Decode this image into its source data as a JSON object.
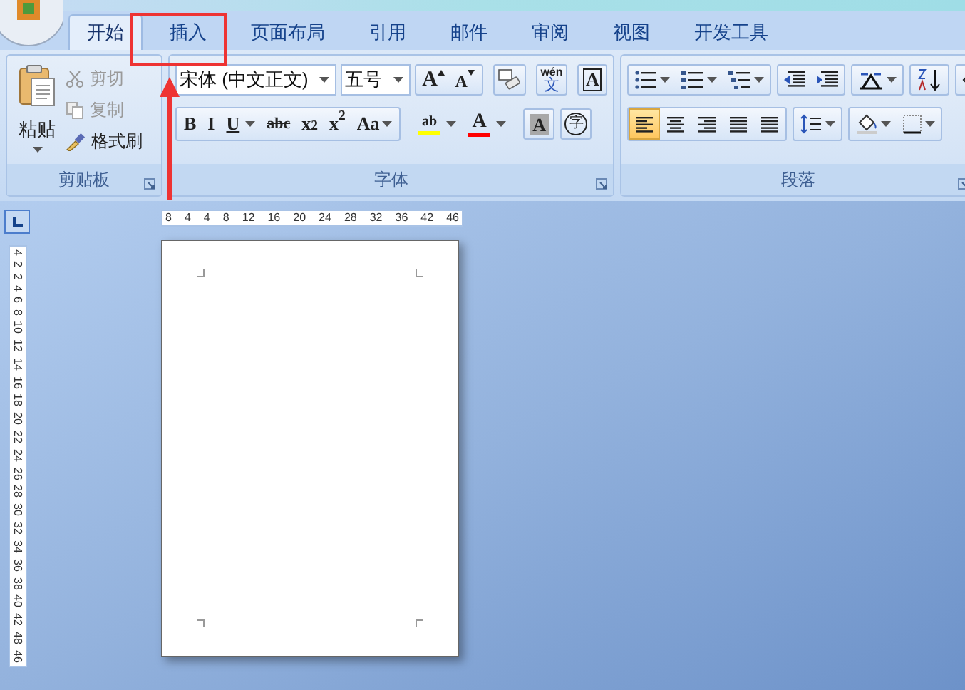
{
  "tabs": [
    {
      "label": "开始",
      "selected": true
    },
    {
      "label": "插入",
      "selected": false
    },
    {
      "label": "页面布局",
      "selected": false
    },
    {
      "label": "引用",
      "selected": false
    },
    {
      "label": "邮件",
      "selected": false
    },
    {
      "label": "审阅",
      "selected": false
    },
    {
      "label": "视图",
      "selected": false
    },
    {
      "label": "开发工具",
      "selected": false
    }
  ],
  "clipboard": {
    "title": "剪贴板",
    "paste": "粘贴",
    "items": [
      {
        "kind": "cut",
        "label": "剪切",
        "disabled": true
      },
      {
        "kind": "copy",
        "label": "复制",
        "disabled": true
      },
      {
        "kind": "painter",
        "label": "格式刷",
        "disabled": false
      }
    ]
  },
  "font": {
    "title": "字体",
    "font_name": "宋体 (中文正文)",
    "font_size": "五号",
    "row1_buttons": [
      {
        "kind": "grow",
        "label": "A"
      },
      {
        "kind": "shrink",
        "label": "A"
      },
      {
        "kind": "clear"
      },
      {
        "kind": "pinyin",
        "label": "wén",
        "sub": "文"
      },
      {
        "kind": "border",
        "label": "A"
      }
    ],
    "row2_buttons": [
      {
        "kind": "text",
        "label": "B"
      },
      {
        "kind": "text",
        "label": "I"
      },
      {
        "kind": "underline",
        "label": "U"
      },
      {
        "kind": "strike",
        "label": "abc"
      },
      {
        "kind": "text",
        "label": "x$_{2}$"
      },
      {
        "kind": "text",
        "label": "x$^{2}$"
      },
      {
        "kind": "case",
        "label": "Aa"
      },
      {
        "kind": "highlight",
        "label": "ab",
        "color": "#ffff00"
      },
      {
        "kind": "fontcolor",
        "label": "A",
        "color": "#ff0000"
      },
      {
        "kind": "shade",
        "label": "A"
      },
      {
        "kind": "circle",
        "label": "字"
      }
    ]
  },
  "paragraph": {
    "title": "段落",
    "alignments": [
      {
        "kind": "left",
        "selected": true
      },
      {
        "kind": "center",
        "selected": false
      },
      {
        "kind": "right",
        "selected": false
      },
      {
        "kind": "justify",
        "selected": false
      },
      {
        "kind": "distributed",
        "selected": false
      }
    ]
  },
  "horizontal_ruler": [
    "8",
    "4",
    "4",
    "8",
    "12",
    "16",
    "20",
    "24",
    "28",
    "32",
    "36",
    "42",
    "46"
  ],
  "vertical_ruler": [
    "4",
    "2",
    "2",
    "4",
    "6",
    "8",
    "10",
    "12",
    "14",
    "16",
    "18",
    "20",
    "22",
    "24",
    "26",
    "28",
    "30",
    "32",
    "34",
    "36",
    "38",
    "40",
    "42",
    "48",
    "46"
  ]
}
